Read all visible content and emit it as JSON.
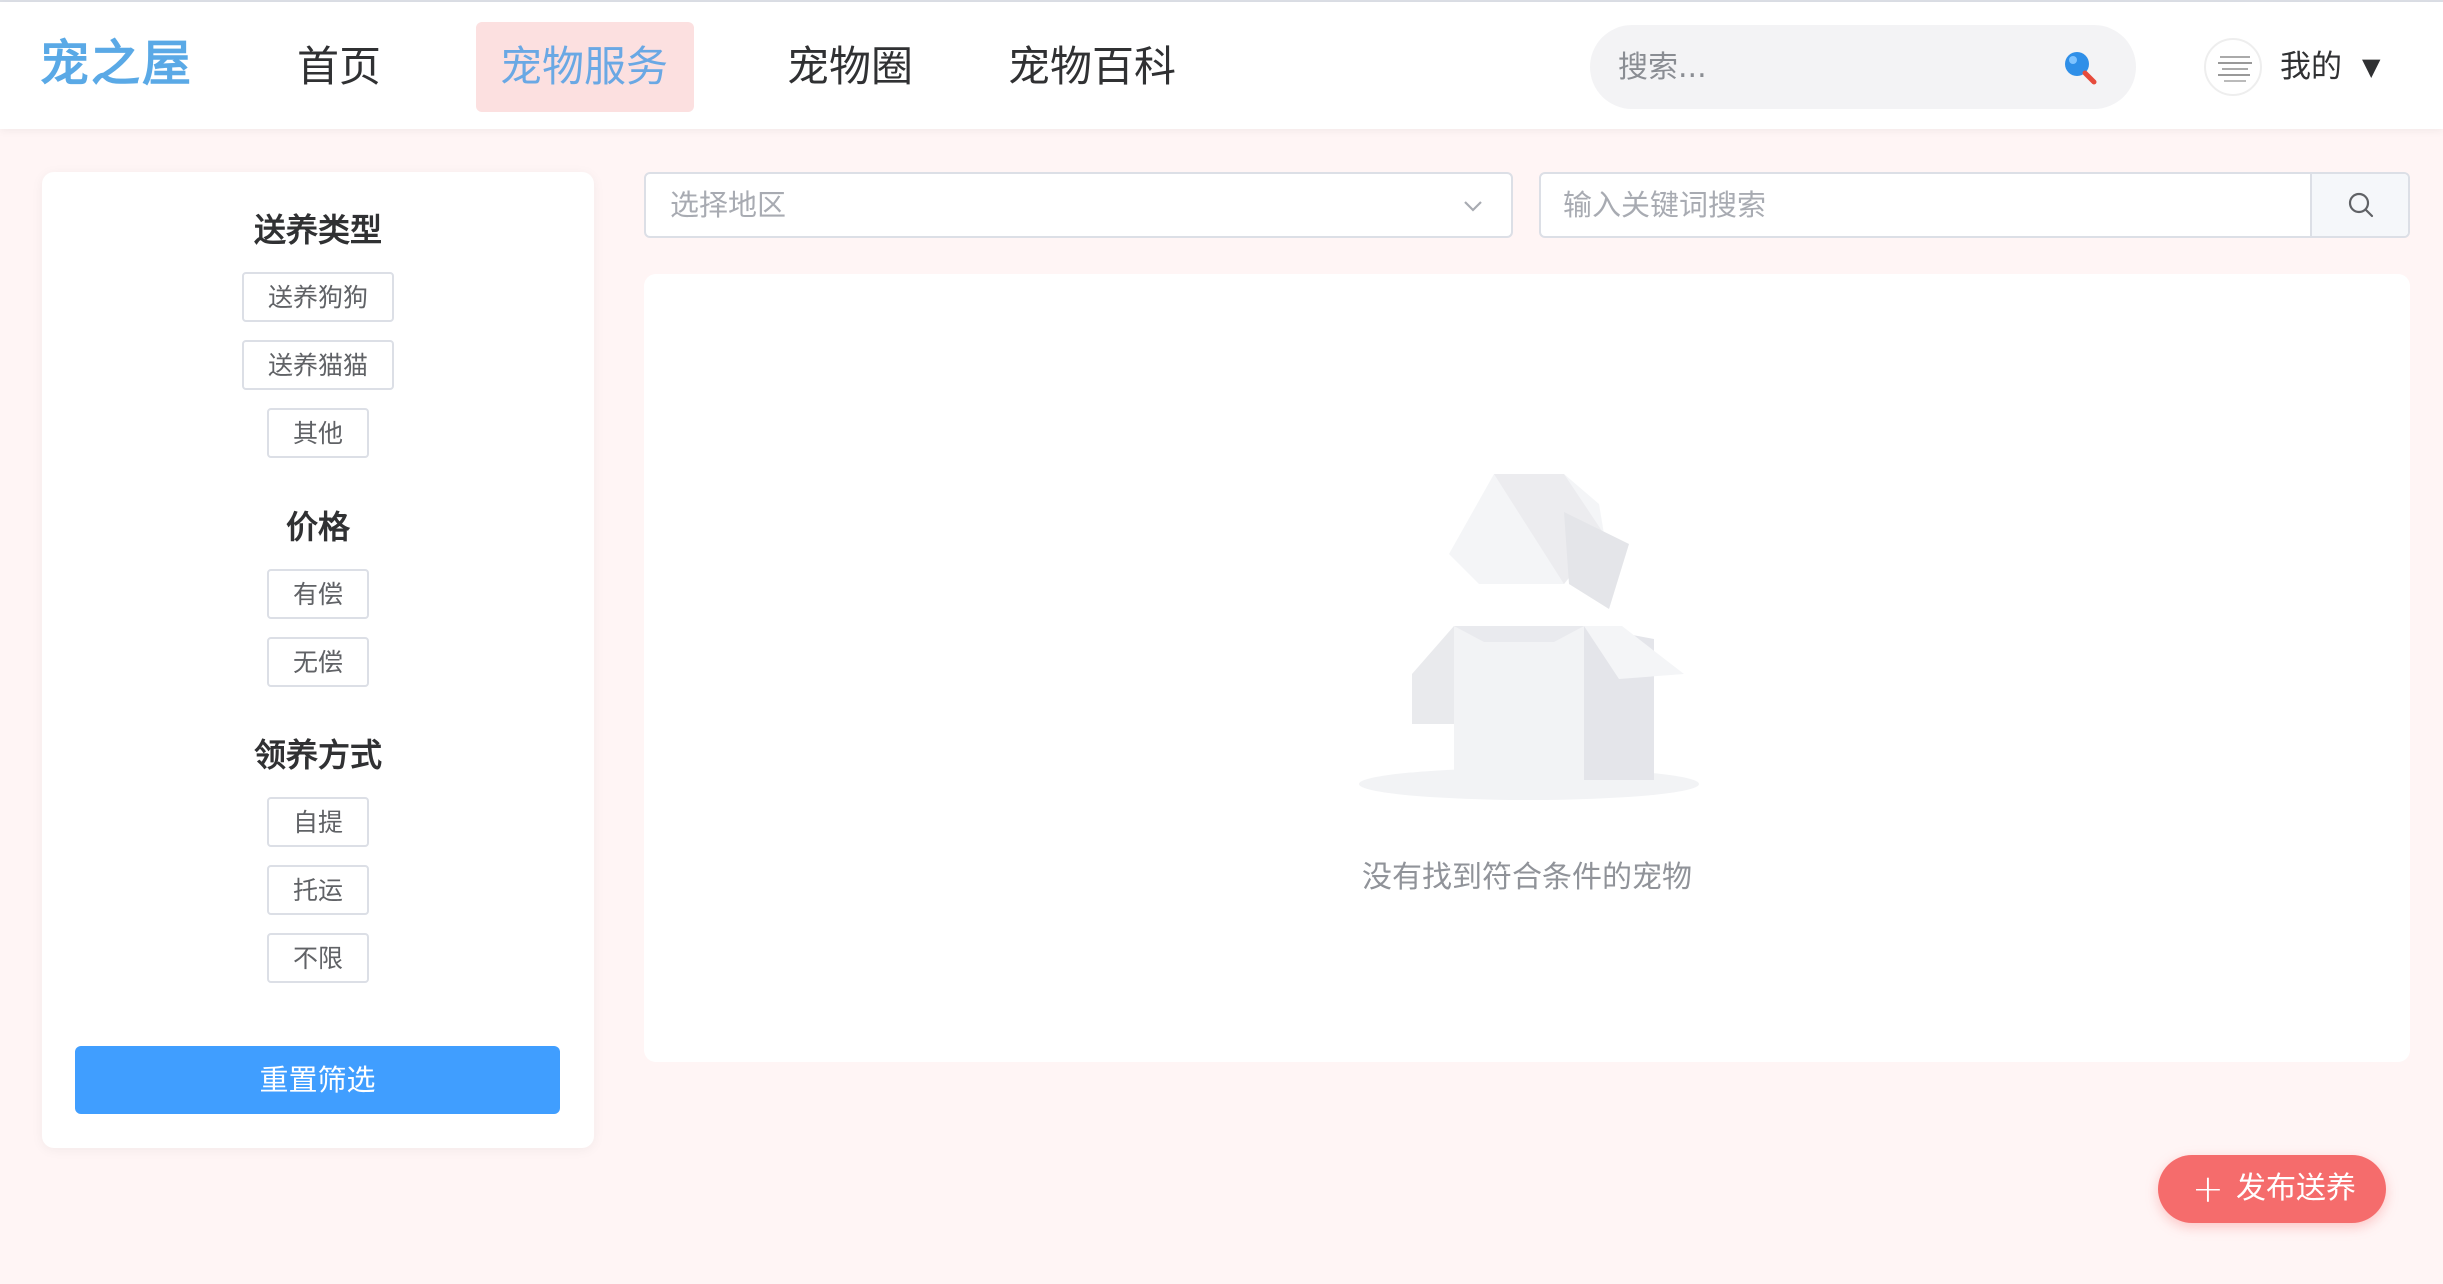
{
  "header": {
    "logo": "宠之屋",
    "nav": [
      {
        "label": "首页",
        "active": false
      },
      {
        "label": "宠物服务",
        "active": true
      },
      {
        "label": "宠物圈",
        "active": false
      },
      {
        "label": "宠物百科",
        "active": false
      }
    ],
    "search_placeholder": "搜索...",
    "user_label": "我的",
    "user_caret": "▼"
  },
  "sidebar": {
    "groups": [
      {
        "title": "送养类型",
        "options": [
          "送养狗狗",
          "送养猫猫",
          "其他"
        ]
      },
      {
        "title": "价格",
        "options": [
          "有偿",
          "无偿"
        ]
      },
      {
        "title": "领养方式",
        "options": [
          "自提",
          "托运",
          "不限"
        ]
      }
    ],
    "reset_label": "重置筛选"
  },
  "filters": {
    "region_placeholder": "选择地区",
    "keyword_placeholder": "输入关键词搜索"
  },
  "results": {
    "empty_text": "没有找到符合条件的宠物"
  },
  "fab": {
    "icon": "+",
    "label": "发布送养"
  },
  "colors": {
    "page_bg": "#fff5f5",
    "brand_blue": "#5aa9e6",
    "active_nav_bg": "#fce0e0",
    "primary_button": "#409eff",
    "fab": "#f56c6c"
  }
}
